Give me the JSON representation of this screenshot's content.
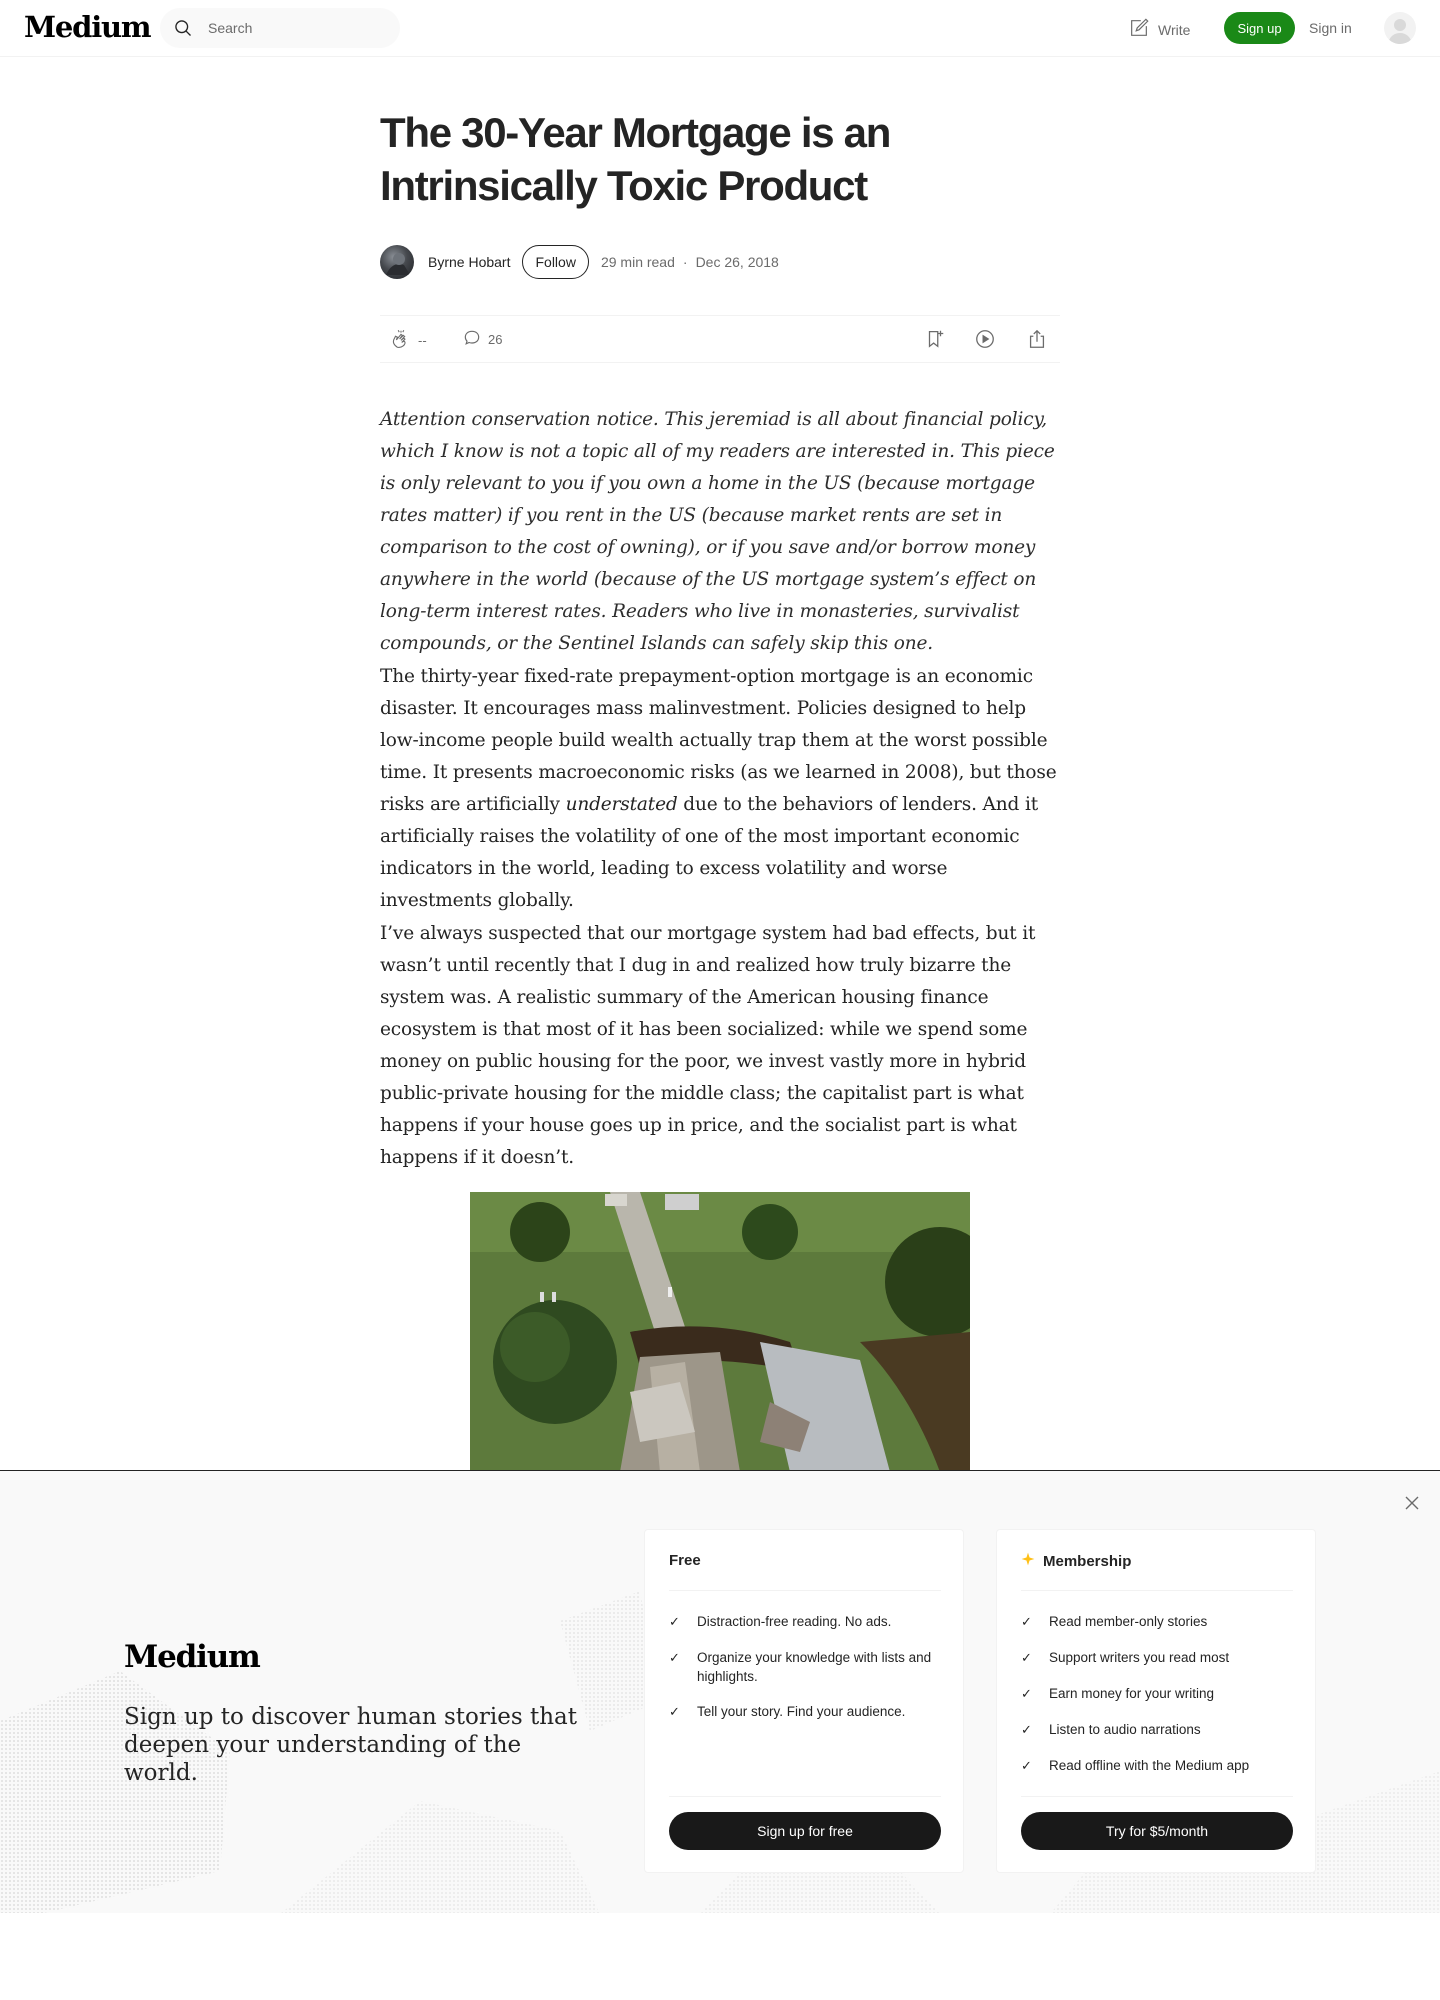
{
  "nav": {
    "logo": "Medium",
    "search_placeholder": "Search",
    "write_label": "Write",
    "signup_label": "Sign up",
    "signin_label": "Sign in"
  },
  "article": {
    "title": "The 30-Year Mortgage is an Intrinsically Toxic Product",
    "author": "Byrne Hobart",
    "follow_label": "Follow",
    "read_time": "29 min read",
    "separator": "·",
    "date": "Dec 26, 2018",
    "claps": "--",
    "responses": "26",
    "paragraph_1": "Attention conservation notice. This jeremiad is all about financial policy, which I know is not a topic all of my readers are interested in. This piece is only relevant to you if you own a home in the US (because mortgage rates matter) if you rent in the US (because market rents are set in comparison to the cost of owning), or if you save and/or borrow money anywhere in the world (because of the US mortgage system’s effect on long-term interest rates. Readers who live in monasteries, survivalist compounds, or the Sentinel Islands can safely skip this one.",
    "paragraph_2_a": "The thirty-year fixed-rate prepayment-option mortgage is an economic disaster. It encourages mass malinvestment. Policies designed to help low-income people build wealth actually trap them at the worst possible time. It presents macroeconomic risks (as we learned in 2008), but those risks are artificially ",
    "paragraph_2_em": "understated",
    "paragraph_2_b": " due to the behaviors of lenders. And it artificially raises the volatility of one of the most important economic indicators in the world, leading to excess volatility and worse investments globally.",
    "paragraph_3": "I’ve always suspected that our mortgage system had bad effects, but it wasn’t until recently that I dug in and realized how truly bizarre the system was. A realistic summary of the American housing finance ecosystem is that most of it has been socialized: while we spend some money on public housing for the poor, we invest vastly more in hybrid public-private housing for the middle class; the capitalist part is what happens if your house goes up in price, and the socialist part is what happens if it doesn’t."
  },
  "signup_modal": {
    "logo": "Medium",
    "tagline": "Sign up to discover human stories that deepen your understanding of the world.",
    "free": {
      "title": "Free",
      "features": [
        "Distraction-free reading. No ads.",
        "Organize your knowledge with lists and highlights.",
        "Tell your story. Find your audience."
      ],
      "button": "Sign up for free"
    },
    "membership": {
      "title": "Membership",
      "features": [
        "Read member-only stories",
        "Support writers you read most",
        "Earn money for your writing",
        "Listen to audio narrations",
        "Read offline with the Medium app"
      ],
      "button": "Try for $5/month"
    }
  },
  "colors": {
    "brand_green": "#1a8917",
    "text": "#242424",
    "muted": "#6b6b6b",
    "button_dark": "#191919",
    "star": "#ffc017"
  },
  "icons": [
    "search-icon",
    "write-icon",
    "user-icon",
    "clap-icon",
    "comment-icon",
    "bookmark-icon",
    "play-icon",
    "share-icon",
    "close-icon",
    "star-icon",
    "check-icon"
  ]
}
